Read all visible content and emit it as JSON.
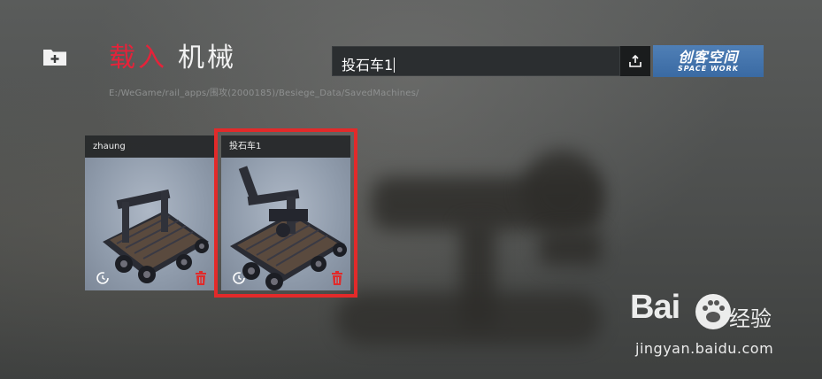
{
  "header": {
    "title_load": "载入",
    "title_machine": "机械",
    "path": "E:/WeGame/rail_apps/围攻(2000185)/Besiege_Data/SavedMachines/"
  },
  "search": {
    "value": "投石车1"
  },
  "workshop": {
    "label_cn": "创客空间",
    "label_en": "SPACE WORK"
  },
  "machines": [
    {
      "name": "zhaung",
      "selected": false
    },
    {
      "name": "投石车1",
      "selected": true
    }
  ],
  "watermark": {
    "logo_left": "Bai",
    "logo_right": "经验",
    "url": "jingyan.baidu.com"
  },
  "colors": {
    "accent_red": "#e4233a",
    "selection": "#e22a2a",
    "workshop_blue": "#4f7fb6"
  }
}
